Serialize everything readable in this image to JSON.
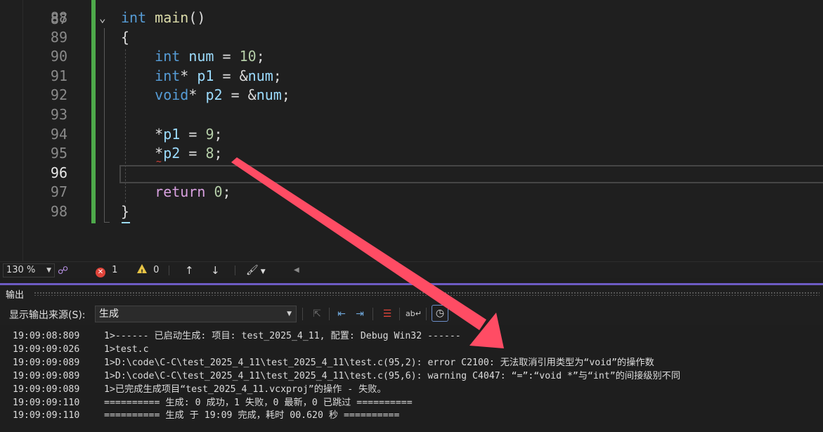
{
  "editor": {
    "partial_top_line_number": "87",
    "lines": [
      {
        "num": "88",
        "segments": [
          [
            "kw",
            "int"
          ],
          [
            "op",
            " "
          ],
          [
            "fn",
            "main"
          ],
          [
            "op",
            "()"
          ]
        ]
      },
      {
        "num": "89",
        "segments": [
          [
            "op",
            "{"
          ]
        ]
      },
      {
        "num": "90",
        "segments": [
          [
            "op",
            "    "
          ],
          [
            "kw",
            "int"
          ],
          [
            "op",
            " "
          ],
          [
            "var",
            "num"
          ],
          [
            "op",
            " = "
          ],
          [
            "num",
            "10"
          ],
          [
            "op",
            ";"
          ]
        ]
      },
      {
        "num": "91",
        "segments": [
          [
            "op",
            "    "
          ],
          [
            "kw",
            "int"
          ],
          [
            "op",
            "* "
          ],
          [
            "var",
            "p1"
          ],
          [
            "op",
            " = &"
          ],
          [
            "var",
            "num"
          ],
          [
            "op",
            ";"
          ]
        ]
      },
      {
        "num": "92",
        "segments": [
          [
            "op",
            "    "
          ],
          [
            "kw",
            "void"
          ],
          [
            "op",
            "* "
          ],
          [
            "var",
            "p2"
          ],
          [
            "op",
            " = &"
          ],
          [
            "var",
            "num"
          ],
          [
            "op",
            ";"
          ]
        ]
      },
      {
        "num": "93",
        "segments": []
      },
      {
        "num": "94",
        "segments": [
          [
            "op",
            "    *"
          ],
          [
            "var",
            "p1"
          ],
          [
            "op",
            " = "
          ],
          [
            "num",
            "9"
          ],
          [
            "op",
            ";"
          ]
        ]
      },
      {
        "num": "95",
        "segments": [
          [
            "op",
            "    *"
          ],
          [
            "var",
            "p2"
          ],
          [
            "op",
            " = "
          ],
          [
            "num",
            "8"
          ],
          [
            "op",
            ";"
          ]
        ]
      },
      {
        "num": "96",
        "segments": []
      },
      {
        "num": "97",
        "segments": [
          [
            "op",
            "    "
          ],
          [
            "kw2",
            "return"
          ],
          [
            "op",
            " "
          ],
          [
            "num",
            "0"
          ],
          [
            "op",
            ";"
          ]
        ]
      },
      {
        "num": "98",
        "segments": [
          [
            "op",
            "}"
          ]
        ]
      }
    ],
    "current_line": "96",
    "colors": {
      "keyword": "#569cd6",
      "return_keyword": "#d8a0df",
      "variable": "#9cdcfe",
      "function": "#dcdcaa",
      "number": "#b5cea8",
      "change_bar": "#4ea94b",
      "error_squiggle": "#e0443a"
    }
  },
  "editor_status": {
    "zoom": "130 %",
    "error_count": "1",
    "warning_count": "0"
  },
  "output": {
    "title": "输出",
    "source_label": "显示输出来源(S):",
    "source_value": "生成",
    "accent_color": "#6d5bc3",
    "lines": [
      {
        "time": "19:09:08:809",
        "text": "1>------ 已启动生成: 项目: test_2025_4_11, 配置: Debug Win32 ------"
      },
      {
        "time": "19:09:09:026",
        "text": "1>test.c"
      },
      {
        "time": "19:09:09:089",
        "text": "1>D:\\code\\C-C\\test_2025_4_11\\test_2025_4_11\\test.c(95,2): error C2100: 无法取消引用类型为“void”的操作数"
      },
      {
        "time": "19:09:09:089",
        "text": "1>D:\\code\\C-C\\test_2025_4_11\\test_2025_4_11\\test.c(95,6): warning C4047: “=”:“void *”与“int”的间接级别不同"
      },
      {
        "time": "19:09:09:089",
        "text": "1>已完成生成项目“test_2025_4_11.vcxproj”的操作 - 失败。"
      },
      {
        "time": "19:09:09:110",
        "text": "========== 生成: 0 成功，1 失败，0 最新，0 已跳过 =========="
      },
      {
        "time": "19:09:09:110",
        "text": "========== 生成 于 19:09 完成，耗时 00.620 秒 =========="
      }
    ]
  },
  "annotation": {
    "arrow_color": "#ff4c64"
  },
  "icons": [
    "chevron-down-icon",
    "intellisense-icon",
    "error-icon",
    "warning-icon",
    "arrow-up-icon",
    "arrow-down-icon",
    "brush-icon",
    "scroll-left-icon",
    "clear-icon",
    "word-wrap-icon",
    "find-message-icon",
    "toggle-icon",
    "clock-icon"
  ]
}
